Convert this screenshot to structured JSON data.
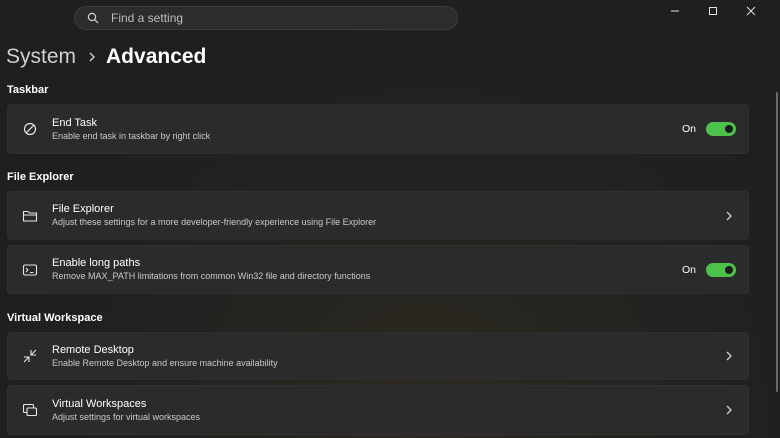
{
  "search": {
    "placeholder": "Find a setting",
    "icon": "search-icon"
  },
  "window_controls": [
    "minimize-icon",
    "maximize-icon",
    "close-icon"
  ],
  "breadcrumb": {
    "parent": "System",
    "current": "Advanced"
  },
  "sections": {
    "taskbar": {
      "title": "Taskbar",
      "end_task": {
        "title": "End Task",
        "desc": "Enable end task in taskbar by right click",
        "toggle_label": "On",
        "toggle_on": true
      }
    },
    "file_explorer": {
      "title": "File Explorer",
      "file_explorer": {
        "title": "File Explorer",
        "desc": "Adjust these settings for a more developer-friendly experience using File Explorer"
      },
      "long_paths": {
        "title": "Enable long paths",
        "desc": "Remove MAX_PATH limitations from common Win32 file and directory functions",
        "toggle_label": "On",
        "toggle_on": true
      }
    },
    "virtual_workspace": {
      "title": "Virtual Workspace",
      "remote_desktop": {
        "title": "Remote Desktop",
        "desc": "Enable Remote Desktop and ensure machine availability"
      },
      "virtual_workspaces": {
        "title": "Virtual Workspaces",
        "desc": "Adjust settings for virtual workspaces"
      }
    }
  },
  "colors": {
    "accent": "#4cc24c",
    "card": "#2b2b2b",
    "background": "#202020"
  }
}
